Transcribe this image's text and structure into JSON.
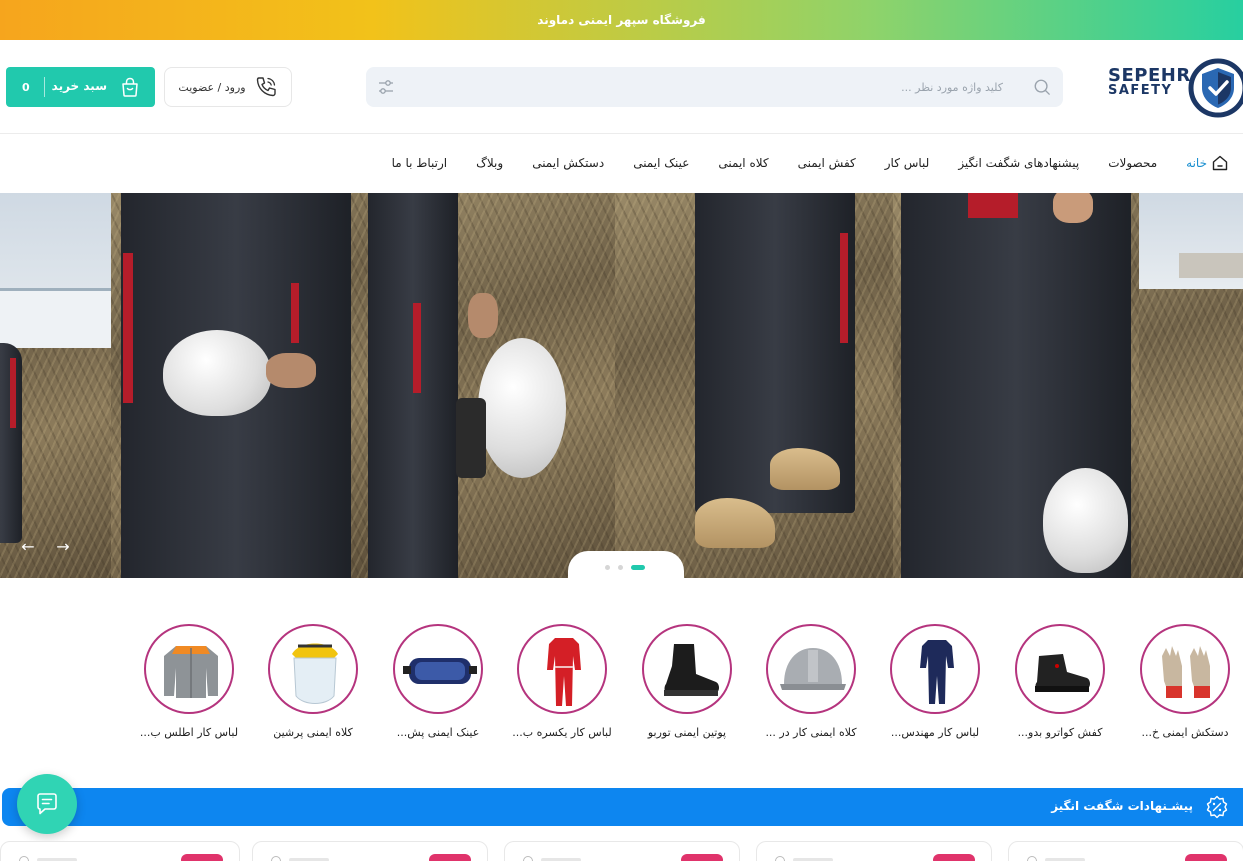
{
  "banner": {
    "text": "فروشگاه سپهر ایمنی دماوند"
  },
  "logo": {
    "line1": "SEPEHR",
    "line2": "SAFETY",
    "color": "#1c3765"
  },
  "search": {
    "placeholder": "کلید واژه مورد نظر ..."
  },
  "header": {
    "login_label": "ورود / عضویت",
    "cart_label": "سبد خرید",
    "cart_count": "0"
  },
  "nav": {
    "items": [
      {
        "label": "خانه"
      },
      {
        "label": "محصولات"
      },
      {
        "label": "پیشنهادهای شگفت انگیز"
      },
      {
        "label": "لباس کار"
      },
      {
        "label": "کفش ایمنی"
      },
      {
        "label": "کلاه ایمنی"
      },
      {
        "label": "عینک ایمنی"
      },
      {
        "label": "دستکش ایمنی"
      },
      {
        "label": "وبلاگ"
      },
      {
        "label": "ارتباط با ما"
      }
    ]
  },
  "slider": {
    "prev": "←",
    "next": "→"
  },
  "categories": [
    {
      "label": "دستکش ایمنی خ..."
    },
    {
      "label": "کفش کواترو بدو..."
    },
    {
      "label": "لباس کار مهندس..."
    },
    {
      "label": "کلاه ایمنی کار در ..."
    },
    {
      "label": "پوتین ایمنی توربو"
    },
    {
      "label": "لباس کار یکسره ب..."
    },
    {
      "label": "عینک ایمنی پش..."
    },
    {
      "label": "کلاه ایمنی پرشین"
    },
    {
      "label": "لباس کار اطلس ب..."
    }
  ],
  "promo": {
    "title": "پیشـنهادات شگفت انگیز"
  },
  "colors": {
    "accent": "#21c9ad",
    "promo": "#0d86f0",
    "category_ring": "#b5347e",
    "nav_active": "#1a8fd0"
  }
}
